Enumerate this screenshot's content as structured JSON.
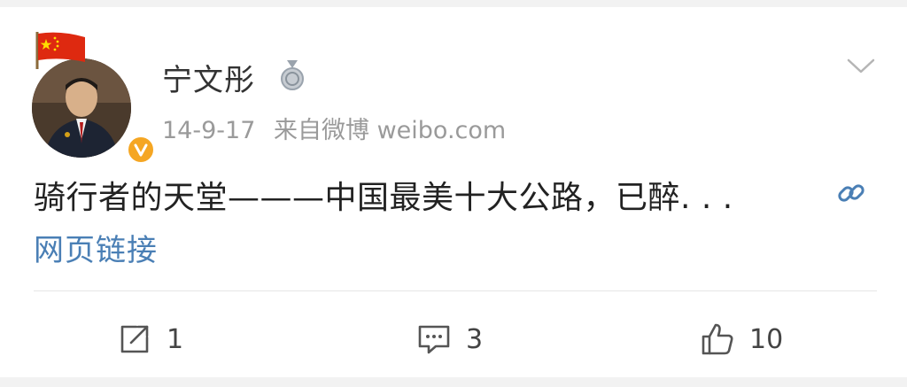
{
  "post": {
    "username": "宁文彤",
    "date": "14-9-17",
    "source": "来自微博 weibo.com",
    "text": "骑行者的天堂———中国最美十大公路，已醉. . .",
    "link_label": "网页链接"
  },
  "actions": {
    "repost_count": "1",
    "comment_count": "3",
    "like_count": "10"
  },
  "colors": {
    "link": "#4a7fb5",
    "verified": "#f5a623",
    "meta_text": "#9a9a9a"
  },
  "icons": {
    "flag": "china-flag-icon",
    "verified": "verified-badge-icon",
    "medal": "medal-icon",
    "chevron": "chevron-down-icon",
    "link": "link-icon",
    "repost": "repost-icon",
    "comment": "comment-icon",
    "like": "thumbs-up-icon"
  }
}
